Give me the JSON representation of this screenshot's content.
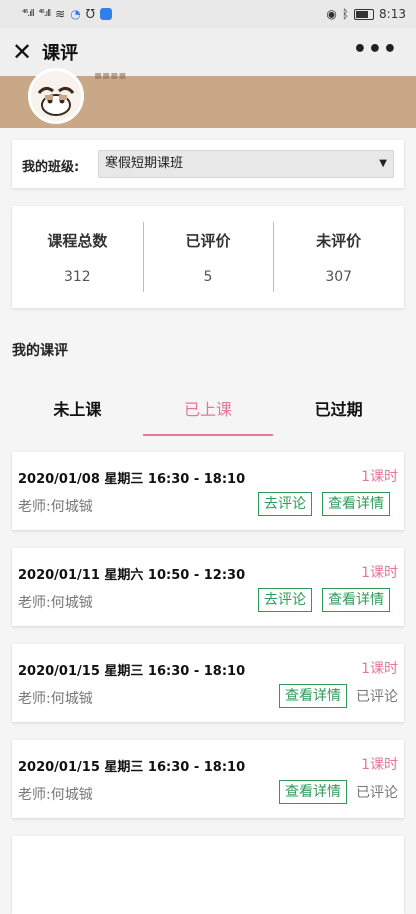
{
  "status_bar": {
    "signal1": "⁴⁶.ıll",
    "signal2": "⁴⁶.ıll",
    "time": "8:13"
  },
  "nav": {
    "title": "课评",
    "close_icon": "close-icon",
    "more_icon": "more-icon"
  },
  "class_select": {
    "label": "我的班级:",
    "value": "寒假短期课班"
  },
  "stats": [
    {
      "label": "课程总数",
      "value": "312"
    },
    {
      "label": "已评价",
      "value": "5"
    },
    {
      "label": "未评价",
      "value": "307"
    }
  ],
  "section_title": "我的课评",
  "tabs": [
    {
      "label": "未上课"
    },
    {
      "label": "已上课"
    },
    {
      "label": "已过期"
    }
  ],
  "active_tab": 1,
  "lessons": [
    {
      "time": "2020/01/08  星期三 16:30 - 18:10",
      "hours": "1课时",
      "teacher": "老师:何城铖",
      "btn1": "去评论",
      "btn2": "查看详情"
    },
    {
      "time": "2020/01/11  星期六 10:50 - 12:30",
      "hours": "1课时",
      "teacher": "老师:何城铖",
      "btn1": "去评论",
      "btn2": "查看详情"
    },
    {
      "time": "2020/01/15  星期三 16:30 - 18:10",
      "hours": "1课时",
      "teacher": "老师:何城铖",
      "btn2": "查看详情",
      "status": "已评论"
    },
    {
      "time": "2020/01/15  星期三 16:30 - 18:10",
      "hours": "1课时",
      "teacher": "老师:何城铖",
      "btn2": "查看详情",
      "status": "已评论"
    }
  ],
  "colors": {
    "accent": "#e0789a",
    "button_green": "#2e9b58",
    "banner": "#c8a887"
  }
}
